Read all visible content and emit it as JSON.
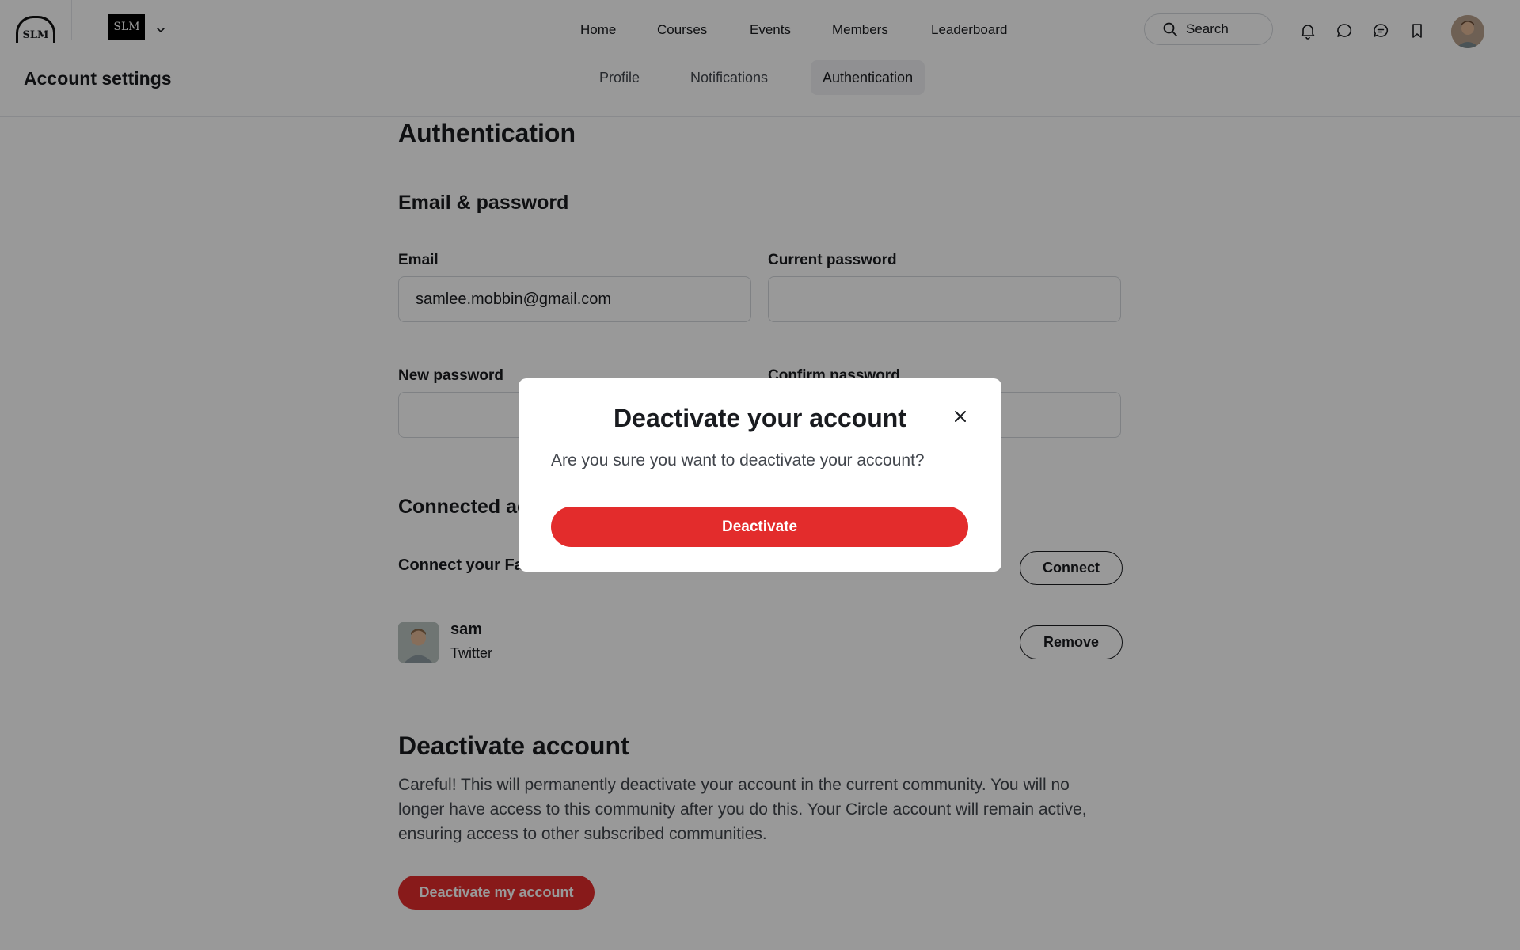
{
  "header": {
    "logo_text": "SLM",
    "brand_text": "SLM",
    "nav": [
      "Home",
      "Courses",
      "Events",
      "Members",
      "Leaderboard"
    ],
    "search_label": "Search",
    "icons": [
      "bell-icon",
      "chat-bubble-icon",
      "messages-icon",
      "bookmark-icon"
    ]
  },
  "subheader": {
    "title": "Account settings",
    "tabs": [
      "Profile",
      "Notifications",
      "Authentication"
    ],
    "active_tab": "Authentication"
  },
  "content": {
    "heading": "Authentication",
    "email_section": {
      "heading": "Email & password",
      "email_label": "Email",
      "email_value": "samlee.mobbin@gmail.com",
      "current_password_label": "Current password",
      "new_password_label": "New password",
      "confirm_password_label": "Confirm password"
    },
    "connected": {
      "heading": "Connected accounts",
      "facebook_text": "Connect your Facebook account",
      "connect_label": "Connect",
      "account_name": "sam",
      "account_provider": "Twitter",
      "remove_label": "Remove"
    },
    "deactivate": {
      "heading": "Deactivate account",
      "description": "Careful! This will permanently deactivate your account in the current community. You will no longer have access to this community after you do this. Your Circle account will remain active, ensuring access to other subscribed communities.",
      "button_label": "Deactivate my account"
    }
  },
  "modal": {
    "title": "Deactivate your account",
    "body": "Are you sure you want to deactivate your account?",
    "confirm_label": "Deactivate"
  },
  "colors": {
    "danger": "#e32c2c",
    "overlay": "rgba(0,0,0,0.40)"
  }
}
